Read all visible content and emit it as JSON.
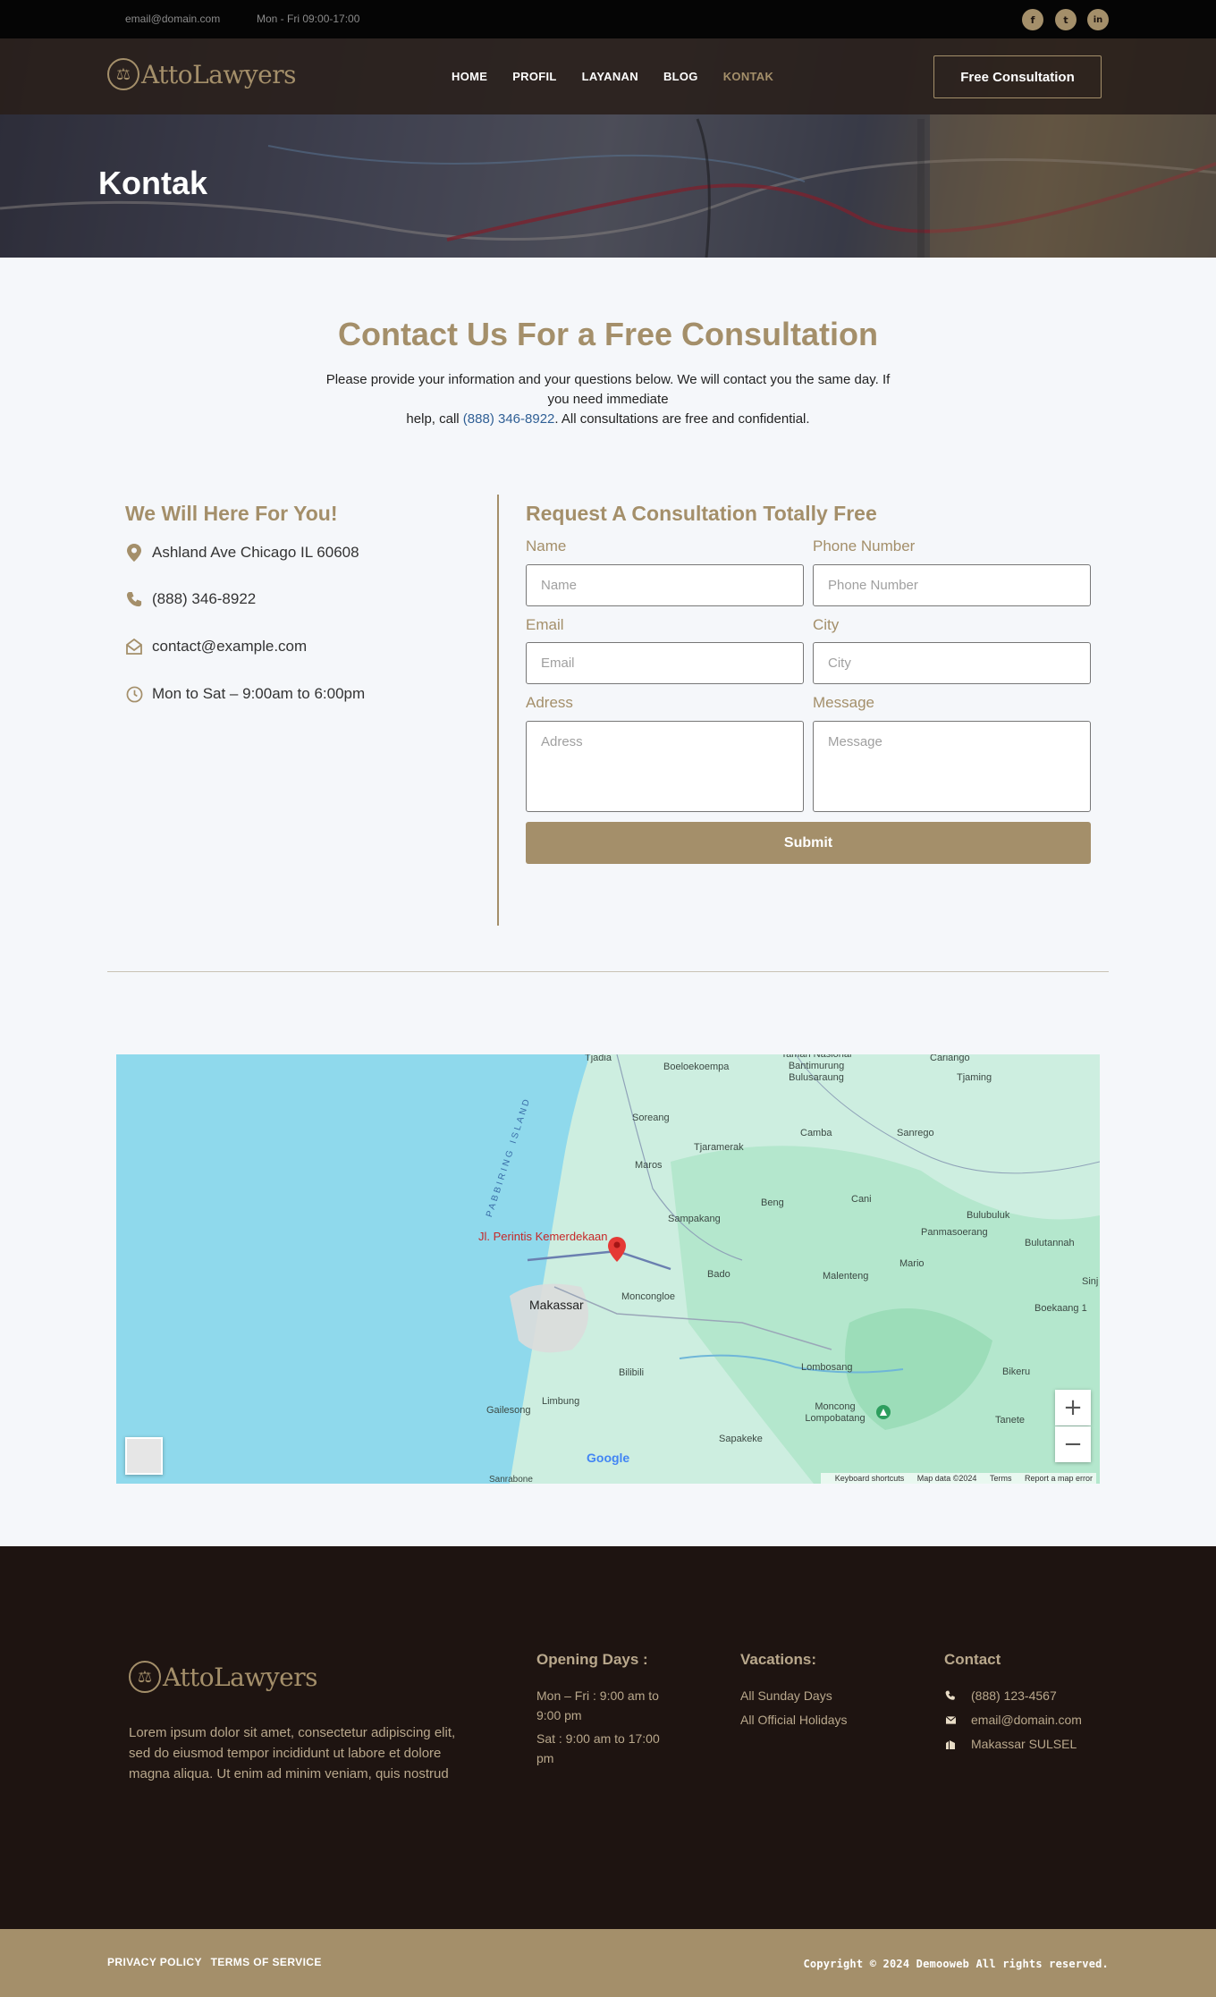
{
  "topbar": {
    "email": "email@domain.com",
    "hours": "Mon - Fri 09:00-17:00",
    "social": [
      {
        "icon": "facebook-icon",
        "glyph": "f"
      },
      {
        "icon": "twitter-icon",
        "glyph": "t"
      },
      {
        "icon": "linkedin-icon",
        "glyph": "in"
      }
    ]
  },
  "header": {
    "logo_text": "AttoLawyers",
    "nav": [
      "HOME",
      "PROFIL",
      "LAYANAN",
      "BLOG",
      "KONTAK"
    ],
    "active_nav": "KONTAK",
    "cta_label": "Free Consultation"
  },
  "hero": {
    "title": "Kontak"
  },
  "intro": {
    "title": "Contact Us For a Free Consultation",
    "text_line1": "Please provide your information and your questions below. We will contact you the same day. If you need immediate",
    "text_line2_prefix": "help, call ",
    "phone": "(888) 346-8922",
    "text_line2_suffix": ". All consultations are free and confidential."
  },
  "contact_info": {
    "title": "We Will Here For You!",
    "items": [
      {
        "icon": "location-pin-icon",
        "text": "Ashland Ave Chicago IL 60608"
      },
      {
        "icon": "phone-icon",
        "text": "(888) 346-8922"
      },
      {
        "icon": "envelope-icon",
        "text": "contact@example.com"
      },
      {
        "icon": "clock-icon",
        "text": "Mon to Sat – 9:00am to 6:00pm"
      }
    ]
  },
  "form": {
    "title": "Request A Consultation Totally Free",
    "fields": {
      "name": {
        "label": "Name",
        "placeholder": "Name"
      },
      "phone": {
        "label": "Phone Number",
        "placeholder": "Phone Number"
      },
      "email": {
        "label": "Email",
        "placeholder": "Email"
      },
      "city": {
        "label": "City",
        "placeholder": "City"
      },
      "address": {
        "label": "Adress",
        "placeholder": "Adress"
      },
      "message": {
        "label": "Message",
        "placeholder": "Message"
      }
    },
    "submit_label": "Submit"
  },
  "map": {
    "marker_label": "Jl. Perintis Kemerdekaan",
    "city_label": "Makassar",
    "places": [
      "Tjadia",
      "Boeloekoempa",
      "Taman Nasional Bantimurung Bulusaraung",
      "Cariango",
      "Tjaming",
      "Soreang",
      "Camba",
      "Sanrego",
      "Tjaramerak",
      "Maros",
      "Beng",
      "Cani",
      "Bulubuluk",
      "Sampakang",
      "Panmasoerang",
      "Bulutannah",
      "Bado",
      "Malenteng",
      "Mario",
      "Sinj",
      "Moncongloe",
      "Boekaang 1",
      "Bilibili",
      "Lombosang",
      "Bikeru",
      "Gailesong",
      "Limbung",
      "Moncong Lompobatang",
      "Tanete",
      "Sapakeke",
      "Sanrabone",
      "PABBIRING ISLAND"
    ],
    "footer": [
      "Keyboard shortcuts",
      "Map data ©2024",
      "Terms",
      "Report a map error"
    ],
    "zoom_in": "+",
    "zoom_out": "−",
    "google": "Google"
  },
  "footer": {
    "logo_text": "AttoLawyers",
    "description": "Lorem ipsum dolor sit amet, consectetur adipiscing elit, sed do eiusmod tempor incididunt ut labore et dolore magna aliqua. Ut enim ad minim veniam, quis nostrud",
    "opening": {
      "title": "Opening Days :",
      "line1": "Mon – Fri : 9:00 am to 9:00 pm",
      "line2": "Sat : 9:00 am to 17:00 pm"
    },
    "vacations": {
      "title": "Vacations:",
      "line1": "All Sunday Days",
      "line2": "All Official Holidays"
    },
    "contact": {
      "title": "Contact",
      "items": [
        {
          "icon": "phone-icon",
          "text": "(888) 123-4567"
        },
        {
          "icon": "envelope-icon",
          "text": "email@domain.com"
        },
        {
          "icon": "building-icon",
          "text": "Makassar SULSEL"
        }
      ]
    }
  },
  "bottombar": {
    "links": [
      "PRIVACY POLICY",
      "TERMS OF SERVICE"
    ],
    "copyright": "Copyright © 2024 Demooweb All rights reserved."
  },
  "colors": {
    "accent": "#a48f6a",
    "dark": "#1e1411",
    "link": "#2f5f95"
  }
}
